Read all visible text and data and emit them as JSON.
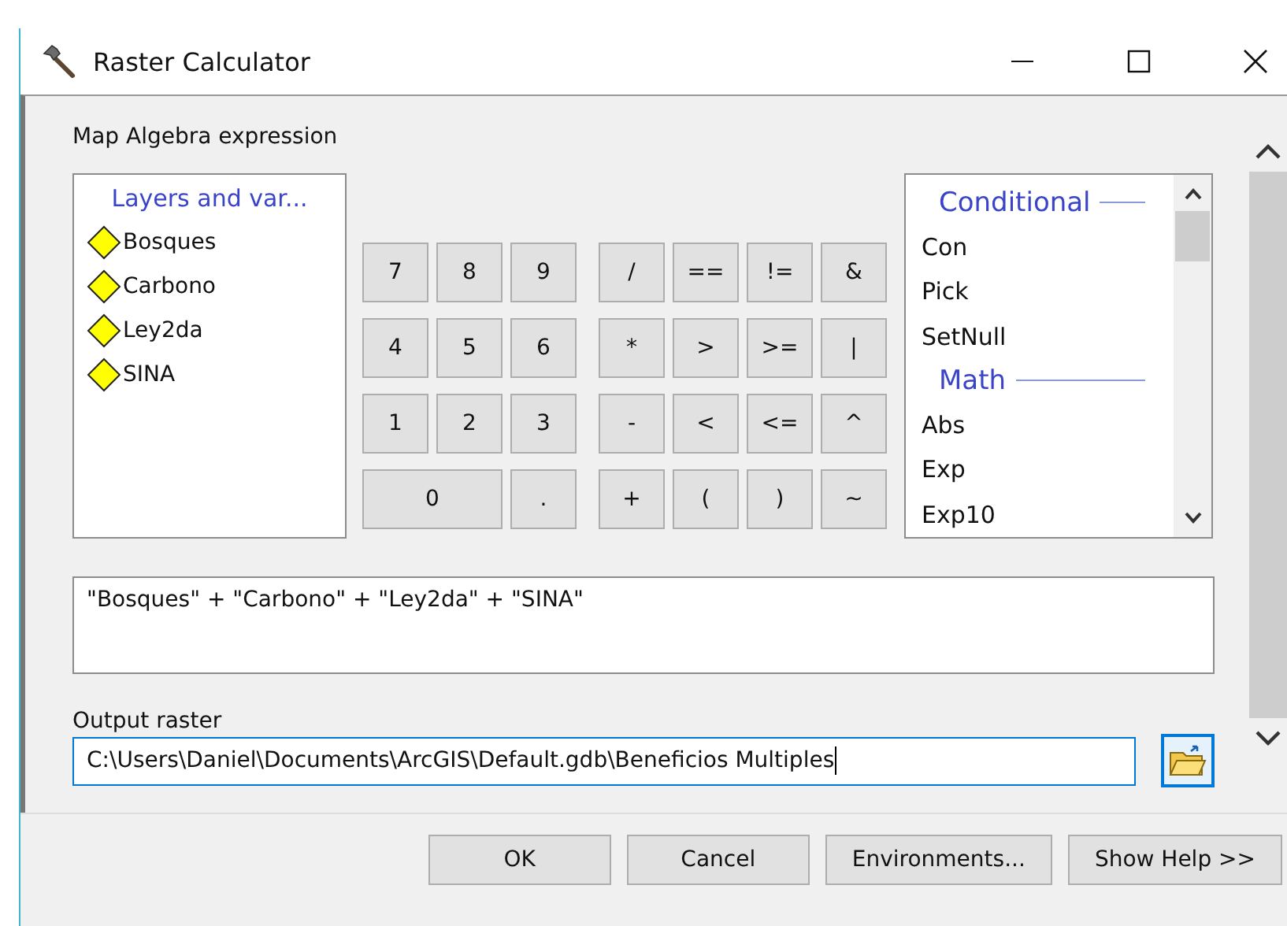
{
  "window": {
    "title": "Raster Calculator"
  },
  "expression_label": "Map Algebra expression",
  "layers": {
    "header": "Layers and var...",
    "items": [
      {
        "label": "Bosques"
      },
      {
        "label": "Carbono"
      },
      {
        "label": "Ley2da"
      },
      {
        "label": "SINA"
      }
    ]
  },
  "number_keys": [
    {
      "label": "7",
      "kind": "key"
    },
    {
      "label": "8",
      "kind": "key"
    },
    {
      "label": "9",
      "kind": "key"
    },
    {
      "label": "4",
      "kind": "key"
    },
    {
      "label": "5",
      "kind": "key"
    },
    {
      "label": "6",
      "kind": "key"
    },
    {
      "label": "1",
      "kind": "key"
    },
    {
      "label": "2",
      "kind": "key"
    },
    {
      "label": "3",
      "kind": "key"
    },
    {
      "label": "0",
      "kind": "wide"
    },
    {
      "label": ".",
      "kind": "key"
    }
  ],
  "operator_keys": [
    "/",
    "==",
    "!=",
    "&",
    "*",
    ">",
    ">=",
    "|",
    "-",
    "<",
    "<=",
    "^",
    "+",
    "(",
    ")",
    "~"
  ],
  "functions": [
    {
      "label": "Conditional",
      "kind": "header"
    },
    {
      "label": "Con",
      "kind": "item"
    },
    {
      "label": "Pick",
      "kind": "item"
    },
    {
      "label": "SetNull",
      "kind": "item"
    },
    {
      "label": "Math",
      "kind": "header"
    },
    {
      "label": "Abs",
      "kind": "item"
    },
    {
      "label": "Exp",
      "kind": "item"
    },
    {
      "label": "Exp10",
      "kind": "item"
    }
  ],
  "expression": "\"Bosques\" + \"Carbono\" + \"Ley2da\" + \"SINA\"",
  "output_label": "Output raster",
  "output_value": "C:\\Users\\Daniel\\Documents\\ArcGIS\\Default.gdb\\Beneficios Multiples",
  "buttons": [
    "OK",
    "Cancel",
    "Environments...",
    "Show Help >>"
  ]
}
